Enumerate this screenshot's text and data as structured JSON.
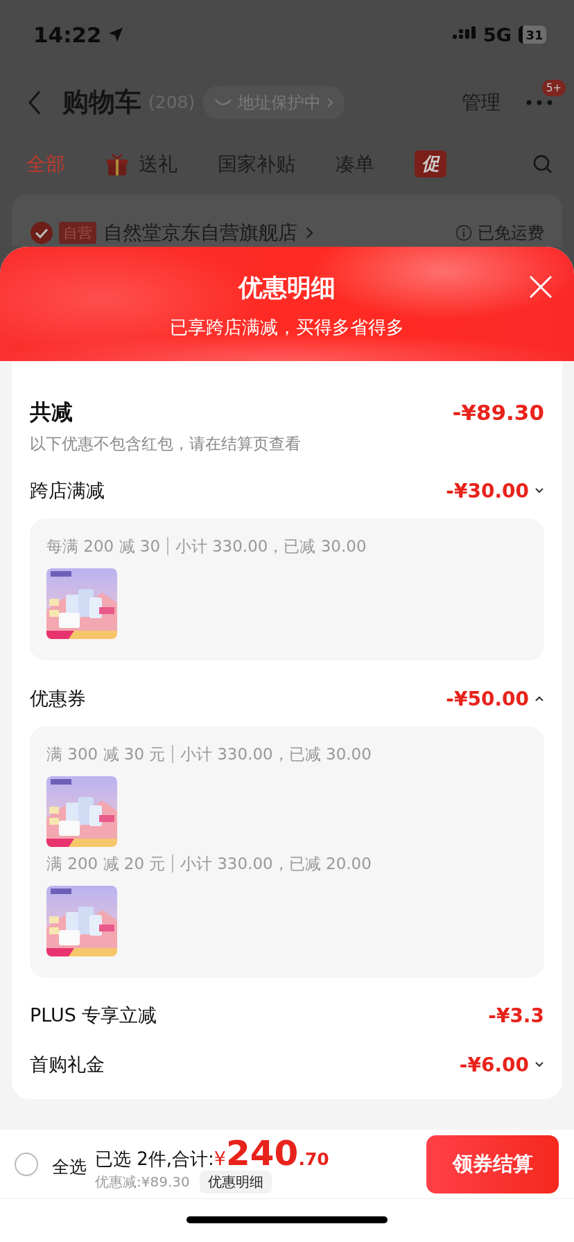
{
  "status_bar": {
    "time": "14:22",
    "network": "5G",
    "battery": "31"
  },
  "nav": {
    "title": "购物车",
    "count": "(208)",
    "address_badge": "地址保护中",
    "manage": "管理",
    "more_badge": "5+"
  },
  "tabs": [
    {
      "label": "全部",
      "kind": "plain",
      "selected": true
    },
    {
      "label": "送礼",
      "kind": "gift",
      "selected": false
    },
    {
      "label": "国家补贴",
      "kind": "plain",
      "selected": false
    },
    {
      "label": "凑单",
      "kind": "plain",
      "selected": false
    },
    {
      "label": "促",
      "kind": "badge",
      "selected": false
    }
  ],
  "store": {
    "checked": true,
    "tag": "自营",
    "name": "自然堂京东自营旗舰店",
    "shipping": "已免运费"
  },
  "sheet": {
    "title": "优惠明细",
    "subtitle": "已享跨店满减，买得多省得多"
  },
  "total": {
    "label": "共减",
    "amount": "-¥89.30",
    "note": "以下优惠不包含红包，请在结算页查看"
  },
  "discounts": [
    {
      "label": "跨店满减",
      "amount": "-¥30.00",
      "kind": "toggle",
      "expanded": false,
      "groups": [
        {
          "rule": "每满 200 减 30",
          "detail": "小计 330.00，已减 30.00"
        }
      ]
    },
    {
      "label": "优惠券",
      "amount": "-¥50.00",
      "kind": "toggle",
      "expanded": true,
      "groups": [
        {
          "rule": "满 300 减 30 元",
          "detail": "小计 330.00，已减 30.00"
        },
        {
          "rule": "满 200 减 20 元",
          "detail": "小计 330.00，已减 20.00"
        }
      ]
    },
    {
      "label": "PLUS 专享立减",
      "amount": "-¥3.3",
      "kind": "plain"
    },
    {
      "label": "首购礼金",
      "amount": "-¥6.00",
      "kind": "toggle",
      "expanded": false
    }
  ],
  "bottom": {
    "select_all": {
      "label": "全选",
      "checked": false
    },
    "summary": "已选 2件,合计:",
    "currency": "¥",
    "price_int": "240",
    "price_dec": ".70",
    "saved": "优惠减:¥89.30",
    "details_link": "优惠明细",
    "checkout": "领券结算"
  }
}
